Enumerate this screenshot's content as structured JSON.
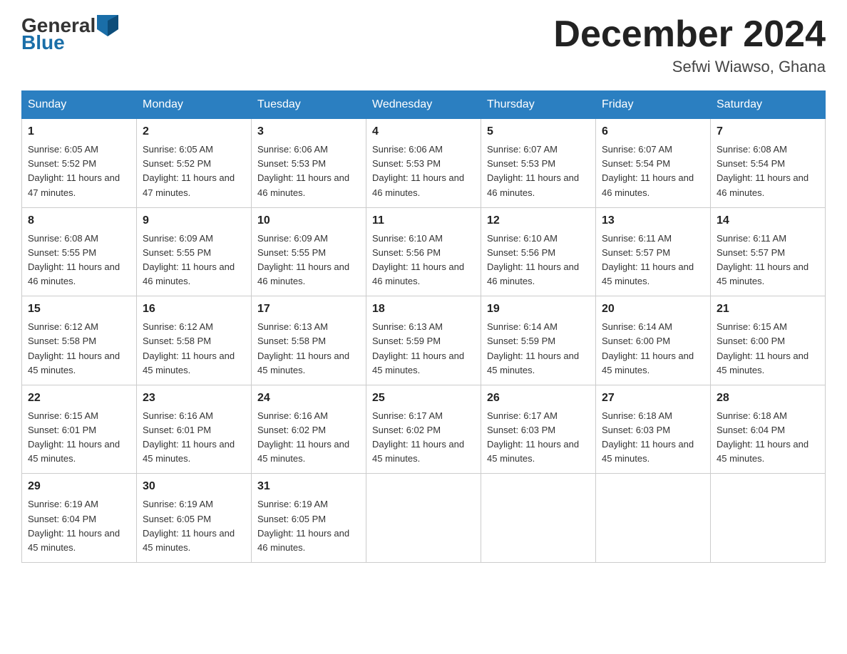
{
  "header": {
    "logo_general": "General",
    "logo_blue": "Blue",
    "month_year": "December 2024",
    "location": "Sefwi Wiawso, Ghana"
  },
  "weekdays": [
    "Sunday",
    "Monday",
    "Tuesday",
    "Wednesday",
    "Thursday",
    "Friday",
    "Saturday"
  ],
  "weeks": [
    [
      {
        "day": "1",
        "sunrise": "6:05 AM",
        "sunset": "5:52 PM",
        "daylight": "11 hours and 47 minutes."
      },
      {
        "day": "2",
        "sunrise": "6:05 AM",
        "sunset": "5:52 PM",
        "daylight": "11 hours and 47 minutes."
      },
      {
        "day": "3",
        "sunrise": "6:06 AM",
        "sunset": "5:53 PM",
        "daylight": "11 hours and 46 minutes."
      },
      {
        "day": "4",
        "sunrise": "6:06 AM",
        "sunset": "5:53 PM",
        "daylight": "11 hours and 46 minutes."
      },
      {
        "day": "5",
        "sunrise": "6:07 AM",
        "sunset": "5:53 PM",
        "daylight": "11 hours and 46 minutes."
      },
      {
        "day": "6",
        "sunrise": "6:07 AM",
        "sunset": "5:54 PM",
        "daylight": "11 hours and 46 minutes."
      },
      {
        "day": "7",
        "sunrise": "6:08 AM",
        "sunset": "5:54 PM",
        "daylight": "11 hours and 46 minutes."
      }
    ],
    [
      {
        "day": "8",
        "sunrise": "6:08 AM",
        "sunset": "5:55 PM",
        "daylight": "11 hours and 46 minutes."
      },
      {
        "day": "9",
        "sunrise": "6:09 AM",
        "sunset": "5:55 PM",
        "daylight": "11 hours and 46 minutes."
      },
      {
        "day": "10",
        "sunrise": "6:09 AM",
        "sunset": "5:55 PM",
        "daylight": "11 hours and 46 minutes."
      },
      {
        "day": "11",
        "sunrise": "6:10 AM",
        "sunset": "5:56 PM",
        "daylight": "11 hours and 46 minutes."
      },
      {
        "day": "12",
        "sunrise": "6:10 AM",
        "sunset": "5:56 PM",
        "daylight": "11 hours and 46 minutes."
      },
      {
        "day": "13",
        "sunrise": "6:11 AM",
        "sunset": "5:57 PM",
        "daylight": "11 hours and 45 minutes."
      },
      {
        "day": "14",
        "sunrise": "6:11 AM",
        "sunset": "5:57 PM",
        "daylight": "11 hours and 45 minutes."
      }
    ],
    [
      {
        "day": "15",
        "sunrise": "6:12 AM",
        "sunset": "5:58 PM",
        "daylight": "11 hours and 45 minutes."
      },
      {
        "day": "16",
        "sunrise": "6:12 AM",
        "sunset": "5:58 PM",
        "daylight": "11 hours and 45 minutes."
      },
      {
        "day": "17",
        "sunrise": "6:13 AM",
        "sunset": "5:58 PM",
        "daylight": "11 hours and 45 minutes."
      },
      {
        "day": "18",
        "sunrise": "6:13 AM",
        "sunset": "5:59 PM",
        "daylight": "11 hours and 45 minutes."
      },
      {
        "day": "19",
        "sunrise": "6:14 AM",
        "sunset": "5:59 PM",
        "daylight": "11 hours and 45 minutes."
      },
      {
        "day": "20",
        "sunrise": "6:14 AM",
        "sunset": "6:00 PM",
        "daylight": "11 hours and 45 minutes."
      },
      {
        "day": "21",
        "sunrise": "6:15 AM",
        "sunset": "6:00 PM",
        "daylight": "11 hours and 45 minutes."
      }
    ],
    [
      {
        "day": "22",
        "sunrise": "6:15 AM",
        "sunset": "6:01 PM",
        "daylight": "11 hours and 45 minutes."
      },
      {
        "day": "23",
        "sunrise": "6:16 AM",
        "sunset": "6:01 PM",
        "daylight": "11 hours and 45 minutes."
      },
      {
        "day": "24",
        "sunrise": "6:16 AM",
        "sunset": "6:02 PM",
        "daylight": "11 hours and 45 minutes."
      },
      {
        "day": "25",
        "sunrise": "6:17 AM",
        "sunset": "6:02 PM",
        "daylight": "11 hours and 45 minutes."
      },
      {
        "day": "26",
        "sunrise": "6:17 AM",
        "sunset": "6:03 PM",
        "daylight": "11 hours and 45 minutes."
      },
      {
        "day": "27",
        "sunrise": "6:18 AM",
        "sunset": "6:03 PM",
        "daylight": "11 hours and 45 minutes."
      },
      {
        "day": "28",
        "sunrise": "6:18 AM",
        "sunset": "6:04 PM",
        "daylight": "11 hours and 45 minutes."
      }
    ],
    [
      {
        "day": "29",
        "sunrise": "6:19 AM",
        "sunset": "6:04 PM",
        "daylight": "11 hours and 45 minutes."
      },
      {
        "day": "30",
        "sunrise": "6:19 AM",
        "sunset": "6:05 PM",
        "daylight": "11 hours and 45 minutes."
      },
      {
        "day": "31",
        "sunrise": "6:19 AM",
        "sunset": "6:05 PM",
        "daylight": "11 hours and 46 minutes."
      },
      null,
      null,
      null,
      null
    ]
  ]
}
